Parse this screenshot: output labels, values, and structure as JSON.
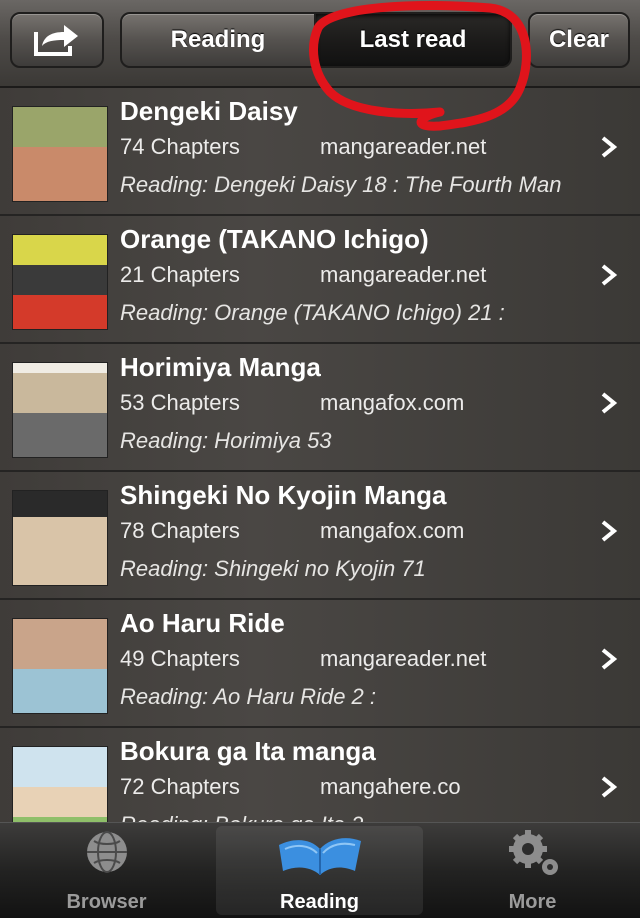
{
  "toolbar": {
    "share_icon": "share-export-icon",
    "segments": [
      "Reading",
      "Last read"
    ],
    "selected_segment": "Last read",
    "clear_label": "Clear"
  },
  "annotation": {
    "type": "hand-drawn circle",
    "color": "#e0141b",
    "target": "Last read"
  },
  "list": {
    "items": [
      {
        "title": "Dengeki Daisy",
        "chapters": "74 Chapters",
        "source": "mangareader.net",
        "reading": "Reading: Dengeki Daisy 18 : The Fourth Man"
      },
      {
        "title": "Orange (TAKANO Ichigo)",
        "chapters": "21 Chapters",
        "source": "mangareader.net",
        "reading": "Reading: Orange (TAKANO Ichigo) 21 :"
      },
      {
        "title": "Horimiya Manga",
        "chapters": "53 Chapters",
        "source": "mangafox.com",
        "reading": "Reading: Horimiya 53"
      },
      {
        "title": "Shingeki No Kyojin Manga",
        "chapters": "78 Chapters",
        "source": "mangafox.com",
        "reading": "Reading: Shingeki no Kyojin 71"
      },
      {
        "title": "Ao Haru Ride",
        "chapters": "49 Chapters",
        "source": "mangareader.net",
        "reading": "Reading: Ao Haru Ride 2 :"
      },
      {
        "title": "Bokura ga Ita manga",
        "chapters": "72 Chapters",
        "source": "mangahere.co",
        "reading": "Reading: Bokura ga Ita 2"
      }
    ]
  },
  "tabbar": {
    "tabs": [
      {
        "label": "Browser",
        "icon": "globe-icon"
      },
      {
        "label": "Reading",
        "icon": "open-book-icon"
      },
      {
        "label": "More",
        "icon": "gears-icon"
      }
    ],
    "active": "Reading"
  },
  "colors": {
    "annotation_red": "#e0141b",
    "book_blue": "#3b8fe0"
  }
}
